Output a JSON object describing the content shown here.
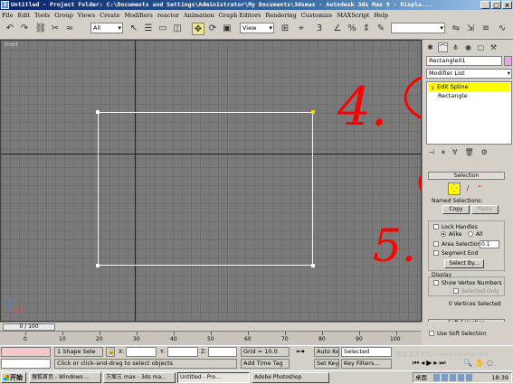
{
  "window": {
    "title": "Untitled   - Project Folder: C:\\Documents and Settings\\Administrator\\My Documents\\3dsmax   - Autodesk 3ds Max 9   - Displa..."
  },
  "menu": [
    "File",
    "Edit",
    "Tools",
    "Group",
    "Views",
    "Create",
    "Modifiers",
    "reactor",
    "Animation",
    "Graph Editors",
    "Rendering",
    "Customize",
    "MAXScript",
    "Help"
  ],
  "toolbar": {
    "selection_filter": "All",
    "ref_coord": "View"
  },
  "viewport": {
    "label": "Front",
    "annotation_4": "4.",
    "annotation_5": "5."
  },
  "command_panel": {
    "object_name": "Rectangle01",
    "object_color": "#e2a8e6",
    "modifier_list": "Modifier List",
    "stack": {
      "item1": "Edit Spline",
      "item2": "Rectangle"
    },
    "selection_rollout": {
      "title": "Selection",
      "named_sel_label": "Named Selections:",
      "copy_label": "Copy",
      "paste_label": "Paste",
      "lock_handles": "Lock Handles",
      "alike": "Alike",
      "all": "All",
      "area_selection": "Area Selection:",
      "area_value": "0.1",
      "segment_end": "Segment End",
      "select_by": "Select By...",
      "display_label": "Display",
      "show_vertex_numbers": "Show Vertex Numbers",
      "selected_only": "Selected Only",
      "vertices_selected": "0 Vertices Selected"
    },
    "soft_selection": "Soft Selection",
    "use_soft_selection": "Use Soft Selection"
  },
  "timeline": {
    "slider_label": "0 / 100",
    "ticks": [
      "0",
      "10",
      "20",
      "30",
      "40",
      "50",
      "60",
      "70",
      "80",
      "90",
      "100"
    ]
  },
  "status": {
    "selection_info": "1 Shape Sele",
    "x_label": "X:",
    "y_label": "Y:",
    "z_label": "Z:",
    "grid": "Grid = 10.0",
    "auto_key": "Auto Key",
    "set_key": "Set Key",
    "key_mode_select": "Selected",
    "key_filters": "Key Filters...",
    "prompt": "Click or click-and-drag to select objects",
    "add_time_tag": "Add Time Tag",
    "watermark": "思缘设计论坛 www.missyuan.net"
  },
  "taskbar": {
    "start": "开始",
    "tasks": [
      "搜狐首页 - Windows ...",
      "方案三 max - 3ds ma...",
      "Untitled   - Pro...",
      "Adobe Photoshop"
    ],
    "tray_label": "桌面",
    "clock": "18:39"
  }
}
